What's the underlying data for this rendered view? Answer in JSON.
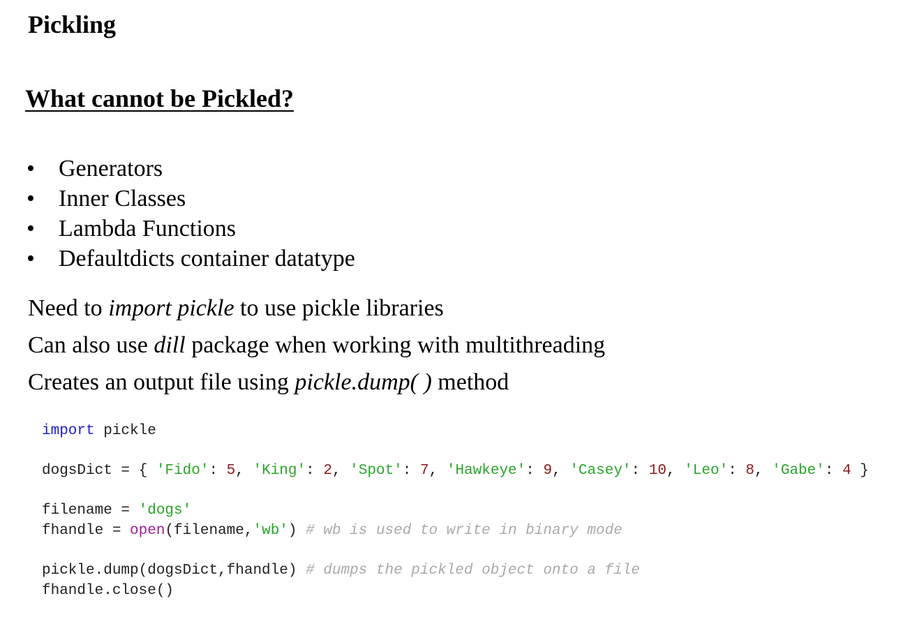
{
  "title": "Pickling",
  "heading": "What cannot be Pickled?",
  "bullet_symbol": "•",
  "bullets": [
    "Generators",
    "Inner Classes",
    "Lambda Functions",
    "Defaultdicts container datatype"
  ],
  "paragraphs": [
    [
      {
        "t": "Need to "
      },
      {
        "t": "import pickle",
        "i": true
      },
      {
        "t": " to use pickle libraries"
      }
    ],
    [
      {
        "t": "Can also use "
      },
      {
        "t": "dill",
        "i": true
      },
      {
        "t": " package when working with multithreading"
      }
    ],
    [
      {
        "t": "Creates an output file using "
      },
      {
        "t": "pickle.dump( )",
        "i": true
      },
      {
        "t": " method"
      }
    ]
  ],
  "code_colors": {
    "keyword": "#2020d0",
    "string": "#2aa52a",
    "number": "#8b1a1a",
    "builtin": "#a0209a",
    "comment": "#aaaaaa"
  },
  "code": [
    [
      {
        "c": "kw",
        "t": "import"
      },
      {
        "t": " pickle"
      }
    ],
    [],
    [
      {
        "t": "dogsDict = { "
      },
      {
        "c": "str",
        "t": "'Fido'"
      },
      {
        "t": ": "
      },
      {
        "c": "num",
        "t": "5"
      },
      {
        "t": ", "
      },
      {
        "c": "str",
        "t": "'King'"
      },
      {
        "t": ": "
      },
      {
        "c": "num",
        "t": "2"
      },
      {
        "t": ", "
      },
      {
        "c": "str",
        "t": "'Spot'"
      },
      {
        "t": ": "
      },
      {
        "c": "num",
        "t": "7"
      },
      {
        "t": ", "
      },
      {
        "c": "str",
        "t": "'Hawkeye'"
      },
      {
        "t": ": "
      },
      {
        "c": "num",
        "t": "9"
      },
      {
        "t": ", "
      },
      {
        "c": "str",
        "t": "'Casey'"
      },
      {
        "t": ": "
      },
      {
        "c": "num",
        "t": "10"
      },
      {
        "t": ", "
      },
      {
        "c": "str",
        "t": "'Leo'"
      },
      {
        "t": ": "
      },
      {
        "c": "num",
        "t": "8"
      },
      {
        "t": ", "
      },
      {
        "c": "str",
        "t": "'Gabe'"
      },
      {
        "t": ": "
      },
      {
        "c": "num",
        "t": "4"
      },
      {
        "t": " }"
      }
    ],
    [],
    [
      {
        "t": "filename = "
      },
      {
        "c": "str",
        "t": "'dogs'"
      }
    ],
    [
      {
        "t": "fhandle = "
      },
      {
        "c": "fn",
        "t": "open"
      },
      {
        "t": "(filename,"
      },
      {
        "c": "str",
        "t": "'wb'"
      },
      {
        "t": ") "
      },
      {
        "c": "cm",
        "t": "# wb is used to write in binary mode"
      }
    ],
    [],
    [
      {
        "t": "pickle.dump(dogsDict,fhandle) "
      },
      {
        "c": "cm",
        "t": "# dumps the pickled object onto a file"
      }
    ],
    [
      {
        "t": "fhandle.close()"
      }
    ]
  ]
}
